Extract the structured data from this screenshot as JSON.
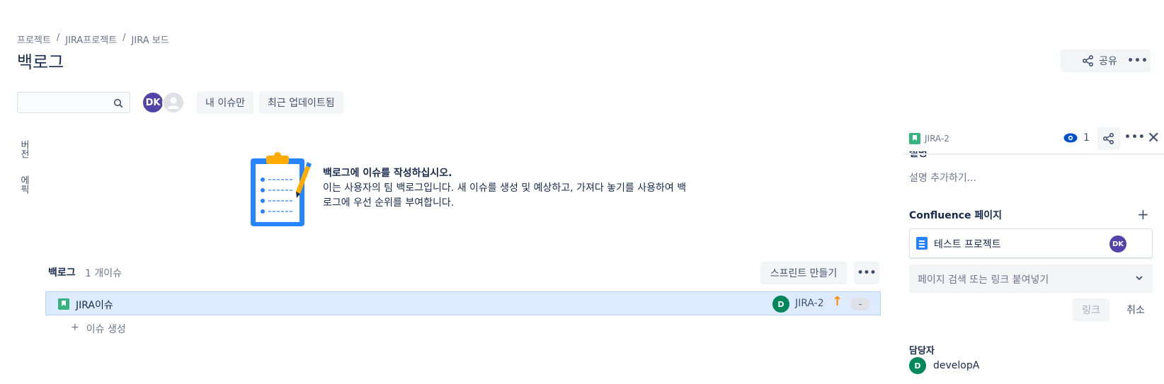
{
  "breadcrumb": {
    "items": [
      "프로젝트",
      "JIRA프로젝트",
      "JIRA 보드"
    ],
    "separator": "/"
  },
  "page": {
    "title": "백로그"
  },
  "header": {
    "share_label": "공유",
    "more_label": "•••"
  },
  "filters": {
    "search_placeholder": "",
    "avatar_initials": "DK",
    "only_my_issues": "내 이슈만",
    "recently_updated": "최근 업데이트됨"
  },
  "side_tabs": {
    "versions": "버전",
    "epics": "에픽"
  },
  "empty_state": {
    "title": "백로그에 이슈를 작성하십시오.",
    "description": "이는 사용자의 팀 백로그입니다. 새 이슈를 생성 및 예상하고, 가져다 놓기를 사용하여 백로그에 우선 순위를 부여합니다."
  },
  "backlog": {
    "title": "백로그",
    "count": "1 개이슈",
    "create_sprint": "스프린트 만들기",
    "more_label": "•••",
    "issues": [
      {
        "summary": "JIRA이슈",
        "assignee_initial": "D",
        "key": "JIRA-2",
        "estimate": "-"
      }
    ],
    "create_issue_plus": "+",
    "create_issue": "이슈 생성"
  },
  "panel": {
    "issue_key": "JIRA-2",
    "watch_count": "1",
    "more_label": "•••",
    "description_label": "설명",
    "description_placeholder": "설명 추가하기...",
    "confluence_label": "Confluence 페이지",
    "confluence_pages": [
      {
        "title": "테스트 프로젝트",
        "avatar": "DK"
      }
    ],
    "confluence_search_placeholder": "페이지 검색 또는 링크 붙여넣기",
    "link_button": "링크",
    "cancel_button": "취소",
    "assignee_label": "담당자",
    "assignee_initial": "D",
    "assignee_name": "developA"
  },
  "colors": {
    "primary_text": "#172b4d",
    "secondary_text": "#6b778c",
    "selected_row": "#deebff",
    "avatar_purple": "#5243aa",
    "avatar_green": "#00875a",
    "story_green": "#36b37e",
    "priority_orange": "#ff8b00"
  }
}
